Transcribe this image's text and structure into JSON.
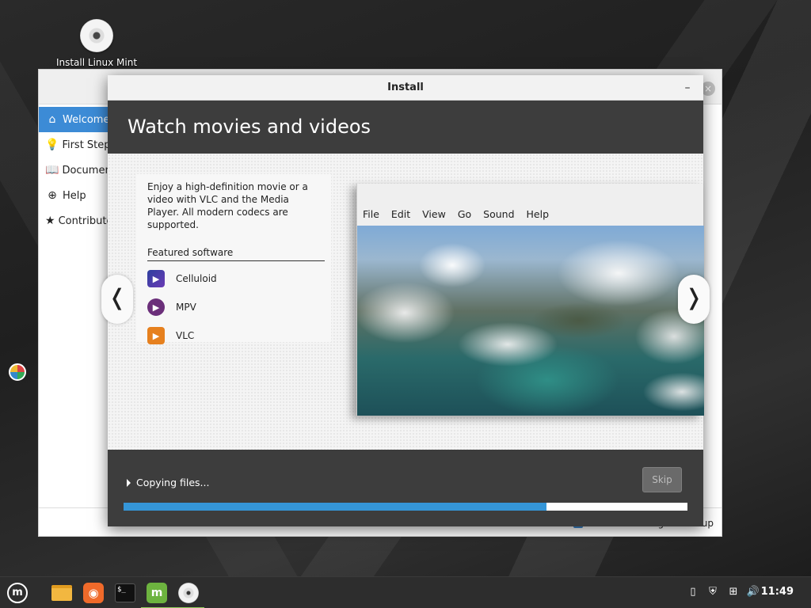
{
  "desktop": {
    "icon_label": "Install Linux Mint"
  },
  "welcome": {
    "sidebar": [
      {
        "icon": "house-icon",
        "glyph": "⌂",
        "label": "Welcome"
      },
      {
        "icon": "lightbulb-icon",
        "glyph": "💡",
        "label": "First Steps"
      },
      {
        "icon": "book-icon",
        "glyph": "📖",
        "label": "Documentation"
      },
      {
        "icon": "lifebuoy-icon",
        "glyph": "⊕",
        "label": "Help"
      },
      {
        "icon": "star-icon",
        "glyph": "★",
        "label": "Contribute"
      }
    ],
    "show_dialog_label": "Show this dialog at startup",
    "close_glyph": "×"
  },
  "install": {
    "title": "Install",
    "minimize_glyph": "–",
    "slide_title": "Watch movies and videos",
    "description": "Enjoy a high-definition movie or a video with VLC and the Media Player. All modern codecs are supported.",
    "featured_title": "Featured software",
    "apps": [
      {
        "name": "Celluloid",
        "icon": "celluloid-icon",
        "glyph": "▶"
      },
      {
        "name": "MPV",
        "icon": "mpv-icon",
        "glyph": "▶"
      },
      {
        "name": "VLC",
        "icon": "vlc-icon",
        "glyph": "▶"
      }
    ],
    "player_menu": [
      "File",
      "Edit",
      "View",
      "Go",
      "Sound",
      "Help"
    ],
    "prev_glyph": "❬",
    "next_glyph": "❭",
    "status": "Copying files...",
    "skip_label": "Skip",
    "progress": 0.75,
    "accent": "#3596d8"
  },
  "taskbar": {
    "clock": "11:49",
    "terminal_text": "$_",
    "mint_glyph": "m",
    "firefox_glyph": "◉"
  }
}
